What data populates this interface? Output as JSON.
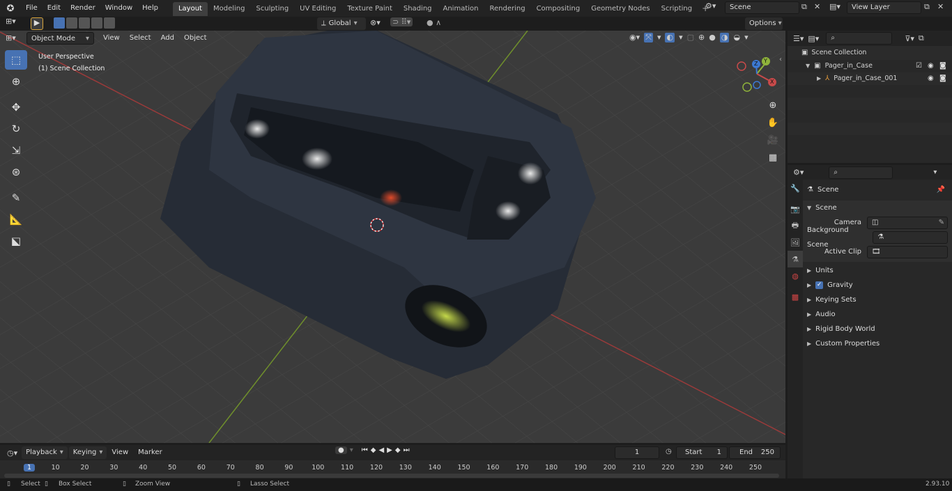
{
  "menu": {
    "file": "File",
    "edit": "Edit",
    "render": "Render",
    "window": "Window",
    "help": "Help"
  },
  "workspaces": [
    "Layout",
    "Modeling",
    "Sculpting",
    "UV Editing",
    "Texture Paint",
    "Shading",
    "Animation",
    "Rendering",
    "Compositing",
    "Geometry Nodes",
    "Scripting"
  ],
  "scene_field": "Scene",
  "view_layer_field": "View Layer",
  "viewport_header": {
    "mode": "Object Mode",
    "view": "View",
    "select": "Select",
    "add": "Add",
    "object": "Object",
    "transform_orientation": "Global",
    "options": "Options"
  },
  "viewport_overlay": {
    "perspective": "User Perspective",
    "collection": "(1) Scene Collection"
  },
  "gizmo": {
    "x": "X",
    "y": "Y",
    "z": "Z"
  },
  "outliner": {
    "root": "Scene Collection",
    "items": [
      {
        "label": "Pager_in_Case"
      },
      {
        "label": "Pager_in_Case_001"
      }
    ]
  },
  "properties": {
    "header": "Scene",
    "section": "Scene",
    "camera_label": "Camera",
    "bg_scene_label": "Background Scene",
    "active_clip_label": "Active Clip",
    "panels": [
      "Units",
      "Gravity",
      "Keying Sets",
      "Audio",
      "Rigid Body World",
      "Custom Properties"
    ]
  },
  "timeline": {
    "playback": "Playback",
    "keying": "Keying",
    "view": "View",
    "marker": "Marker",
    "current_frame": "1",
    "start_label": "Start",
    "start_value": "1",
    "end_label": "End",
    "end_value": "250",
    "ruler": [
      "1",
      "10",
      "20",
      "30",
      "40",
      "50",
      "60",
      "70",
      "80",
      "90",
      "100",
      "110",
      "120",
      "130",
      "140",
      "150",
      "160",
      "170",
      "180",
      "190",
      "200",
      "210",
      "220",
      "230",
      "240",
      "250"
    ]
  },
  "status": {
    "select": "Select",
    "box_select": "Box Select",
    "zoom_view": "Zoom View",
    "lasso_select": "Lasso Select",
    "version": "2.93.10"
  },
  "colors": {
    "accent": "#4772b3",
    "x_axis": "#c84a4a",
    "y_axis": "#8fb33b",
    "z_axis": "#3c79d3"
  }
}
